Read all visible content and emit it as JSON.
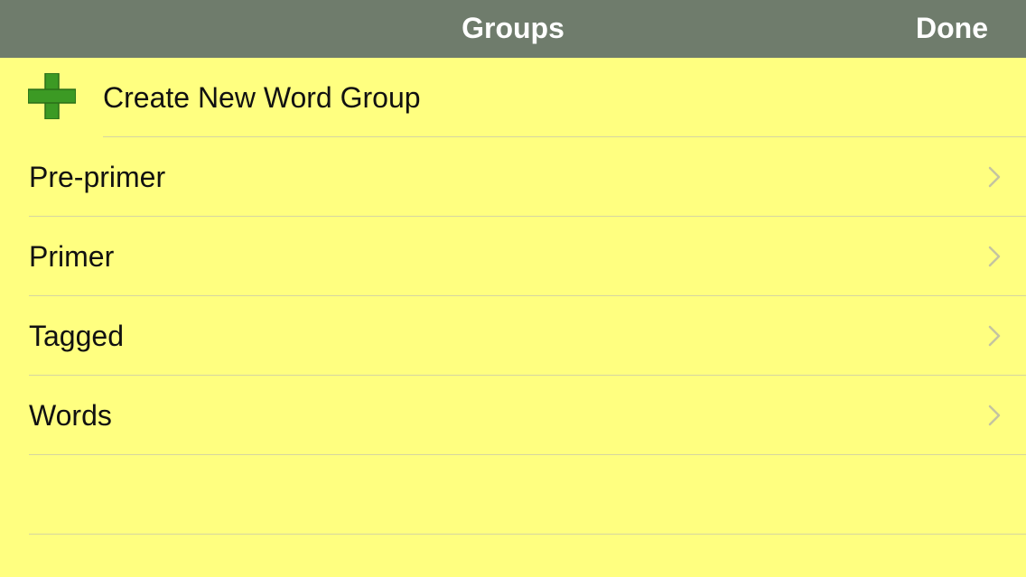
{
  "nav": {
    "title": "Groups",
    "done_label": "Done"
  },
  "create": {
    "icon": "plus-icon",
    "label": "Create New Word Group"
  },
  "groups": [
    {
      "label": "Pre-primer",
      "icon": "chevron-right-icon"
    },
    {
      "label": "Primer",
      "icon": "chevron-right-icon"
    },
    {
      "label": "Tagged",
      "icon": "chevron-right-icon"
    },
    {
      "label": "Words",
      "icon": "chevron-right-icon"
    }
  ],
  "colors": {
    "nav_background": "#6F7C6C",
    "list_background": "#FFFF80",
    "plus_green": "#3C9A24",
    "chevron": "#C4C4A0"
  }
}
